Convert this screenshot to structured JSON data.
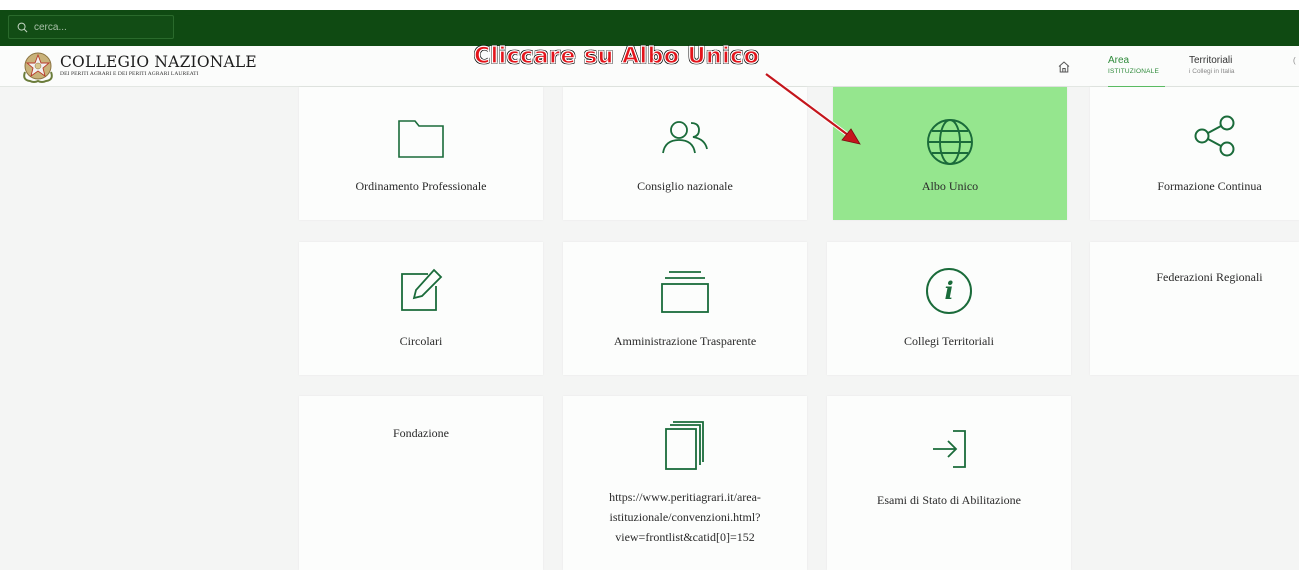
{
  "search": {
    "placeholder": "cerca..."
  },
  "brand": {
    "title": "COLLEGIO NAZIONALE",
    "subtitle": "DEI PERITI AGRARI E DEI PERITI AGRARI LAUREATI"
  },
  "annotation": "Cliccare su Albo Unico",
  "nav": {
    "area": {
      "title": "Area",
      "subtitle": "ISTITUZIONALE"
    },
    "territoriali": {
      "title": "Territoriali",
      "subtitle": "i Collegi in Italia"
    },
    "more": "("
  },
  "colors": {
    "topbar": "#0f4a12",
    "accent": "#1a6b3a",
    "highlight": "#95e68e",
    "annotation": "#e3141b"
  },
  "cards": [
    {
      "label": "Ordinamento Professionale",
      "icon": "folder-icon"
    },
    {
      "label": "Consiglio nazionale",
      "icon": "users-icon"
    },
    {
      "label": "Albo Unico",
      "icon": "globe-icon"
    },
    {
      "label": "Formazione Continua",
      "icon": "share-icon"
    },
    {
      "label": "Circolari",
      "icon": "edit-icon"
    },
    {
      "label": "Amministrazione Trasparente",
      "icon": "archive-icon"
    },
    {
      "label": "Collegi Territoriali",
      "icon": "info-icon"
    },
    {
      "label": "Federazioni Regionali",
      "icon": ""
    },
    {
      "label": "Fondazione",
      "icon": ""
    },
    {
      "label": "https://www.peritiagrari.it/area-istituzionale/convenzioni.html?view=frontlist&catid[0]=152",
      "label_lines": [
        "https://www.peritiagrari.it/area-",
        "istituzionale/convenzioni.html?",
        "view=frontlist&catid[0]=152"
      ],
      "icon": "copy-icon"
    },
    {
      "label": "Esami di Stato di Abilitazione",
      "icon": "login-icon"
    }
  ]
}
